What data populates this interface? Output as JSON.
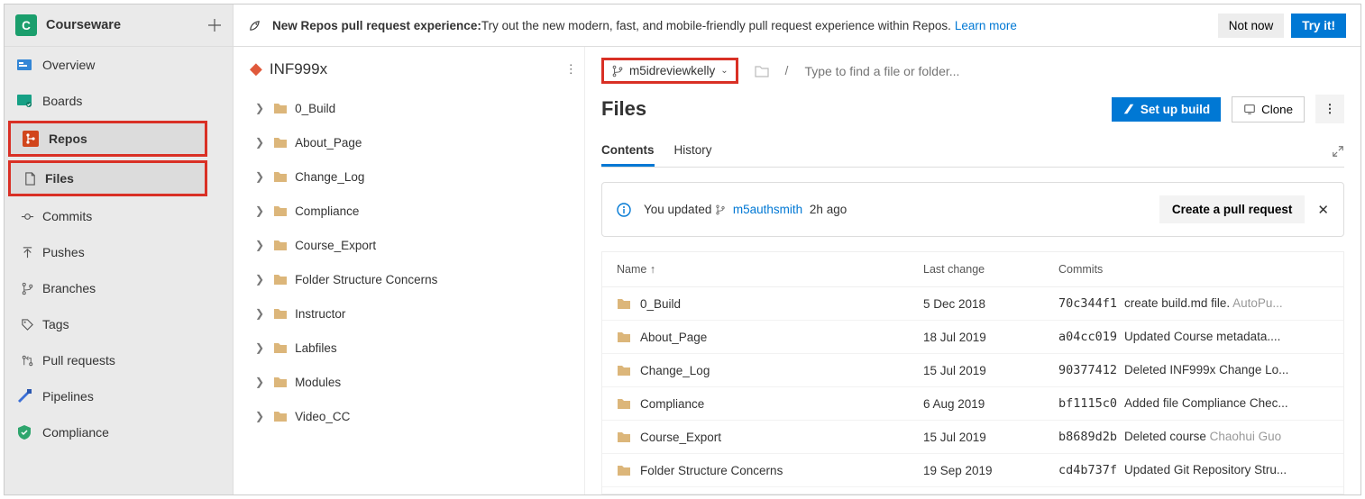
{
  "project": {
    "avatar_letter": "C",
    "name": "Courseware"
  },
  "nav": {
    "overview": "Overview",
    "boards": "Boards",
    "repos": "Repos",
    "files": "Files",
    "commits": "Commits",
    "pushes": "Pushes",
    "branches": "Branches",
    "tags": "Tags",
    "pull_requests": "Pull requests",
    "pipelines": "Pipelines",
    "compliance": "Compliance"
  },
  "banner": {
    "strong": "New Repos pull request experience:",
    "rest": " Try out the new modern, fast, and mobile-friendly pull request experience within Repos. ",
    "learn_more": "Learn more",
    "not_now": "Not now",
    "try_it": "Try it!"
  },
  "repo": {
    "name": "INF999x",
    "folders": [
      "0_Build",
      "About_Page",
      "Change_Log",
      "Compliance",
      "Course_Export",
      "Folder Structure Concerns",
      "Instructor",
      "Labfiles",
      "Modules",
      "Video_CC"
    ]
  },
  "branch": {
    "name": "m5idreviewkelly"
  },
  "breadcrumb": {
    "placeholder": "Type to find a file or folder..."
  },
  "page": {
    "title": "Files",
    "setup_build": "Set up build",
    "clone": "Clone"
  },
  "tabs": {
    "contents": "Contents",
    "history": "History"
  },
  "alert": {
    "prefix": "You updated ",
    "branch": "m5authsmith",
    "when": " 2h ago",
    "create_pr": "Create a pull request"
  },
  "table": {
    "headers": {
      "name": "Name",
      "last_change": "Last change",
      "commits": "Commits"
    },
    "rows": [
      {
        "name": "0_Build",
        "change": "5 Dec 2018",
        "hash": "70c344f1",
        "msg": "create build.md file. ",
        "tail": "AutoPu..."
      },
      {
        "name": "About_Page",
        "change": "18 Jul 2019",
        "hash": "a04cc019",
        "msg": "Updated Course metadata....",
        "tail": ""
      },
      {
        "name": "Change_Log",
        "change": "15 Jul 2019",
        "hash": "90377412",
        "msg": "Deleted INF999x Change Lo...",
        "tail": ""
      },
      {
        "name": "Compliance",
        "change": "6 Aug 2019",
        "hash": "bf1115c0",
        "msg": "Added file Compliance Chec...",
        "tail": ""
      },
      {
        "name": "Course_Export",
        "change": "15 Jul 2019",
        "hash": "b8689d2b",
        "msg": "Deleted course ",
        "tail": "Chaohui Guo"
      },
      {
        "name": "Folder Structure Concerns",
        "change": "19 Sep 2019",
        "hash": "cd4b737f",
        "msg": "Updated Git Repository Stru...",
        "tail": ""
      }
    ]
  }
}
